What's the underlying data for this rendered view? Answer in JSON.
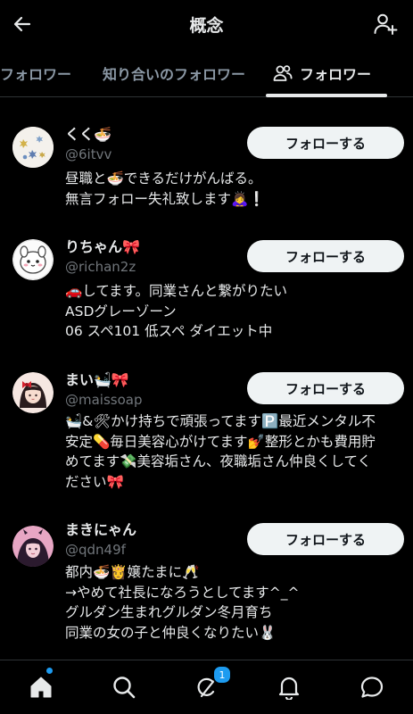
{
  "header": {
    "title": "概念"
  },
  "tabs": [
    {
      "label": "フォロワー"
    },
    {
      "label": "知り合いのフォロワー"
    },
    {
      "label": "フォロワー",
      "active": true
    }
  ],
  "users": [
    {
      "name": "くく🍜",
      "handle": "@6itvv",
      "bio": "昼職と🍜できるだけがんばる。\n無言フォロー失礼致します🙇‍♀️❕",
      "follow_label": "フォローする"
    },
    {
      "name": "りちゃん🎀",
      "handle": "@richan2z",
      "bio": "🚗してます。同業さんと繋がりたい\nASDグレーゾーン\n06 スペ101 低スペ ダイエット中",
      "follow_label": "フォローする"
    },
    {
      "name": "まい🛀🎀",
      "handle": "@maissoap",
      "bio": "🛀&🛠かけ持ちで頑張ってます🅿️最近メンタル不\n安定💊毎日美容心がけてます💅整形とかも費用貯\nめてます💸美容垢さん、夜職垢さん仲良くしてく\nださい🎀",
      "follow_label": "フォローする"
    },
    {
      "name": "まきにゃん",
      "handle": "@qdn49f",
      "bio": "都内🍜👸嬢たまに🥂\n→やめて社長になろうとしてます^_^\nグルダン生まれグルダン冬月育ち\n同業の女の子と仲良くなりたい🐰",
      "follow_label": "フォローする"
    }
  ],
  "bottom_nav": {
    "items": [
      "home-icon",
      "search-icon",
      "grok-icon",
      "notifications-icon",
      "messages-icon"
    ],
    "badge": "1"
  },
  "colors": {
    "background": "#000000",
    "text": "#e7e9ea",
    "muted": "#71767b",
    "button_bg": "#eff3f4",
    "accent": "#1d9bf0"
  }
}
